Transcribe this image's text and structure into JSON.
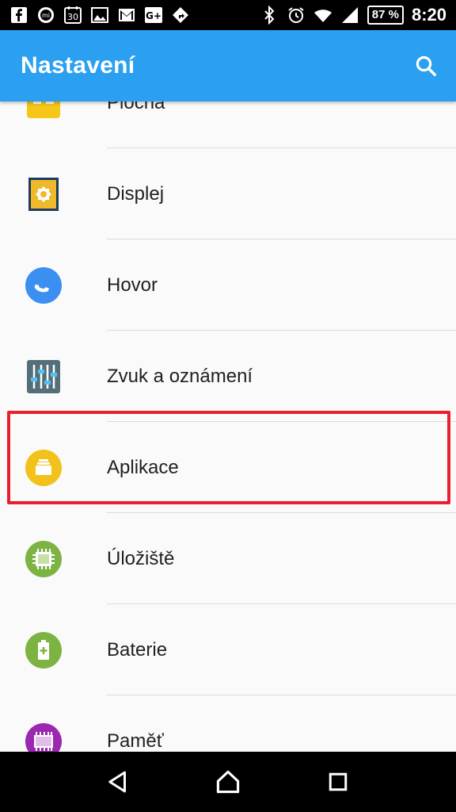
{
  "status_bar": {
    "left_icons": [
      "facebook-icon",
      "mi-icon",
      "calendar-icon",
      "gallery-icon",
      "gmail-icon",
      "google-plus-icon",
      "maps-icon"
    ],
    "calendar_day": "30",
    "google_plus_text": "G+",
    "mi_text": "mi",
    "battery_percent": "87 %",
    "time": "8:20"
  },
  "app_bar": {
    "title": "Nastavení",
    "search_icon": "search-icon"
  },
  "settings_items": [
    {
      "label": "Plocha",
      "icon": "home-screen-icon",
      "color": "#f5c518"
    },
    {
      "label": "Displej",
      "icon": "display-icon",
      "color": "#f0b929"
    },
    {
      "label": "Hovor",
      "icon": "phone-icon",
      "color": "#3b8ff0"
    },
    {
      "label": "Zvuk a oznámení",
      "icon": "sound-sliders-icon",
      "color": "#546e7a"
    },
    {
      "label": "Aplikace",
      "icon": "apps-icon",
      "color": "#f2c21b"
    },
    {
      "label": "Úložiště",
      "icon": "storage-icon",
      "color": "#7cb342"
    },
    {
      "label": "Baterie",
      "icon": "battery-icon",
      "color": "#7cb342"
    },
    {
      "label": "Paměť",
      "icon": "memory-icon",
      "color": "#9c27b0"
    }
  ],
  "highlight_color": "#e8202f",
  "nav_bar": {
    "buttons": [
      "back-icon",
      "home-icon",
      "recents-icon"
    ]
  }
}
